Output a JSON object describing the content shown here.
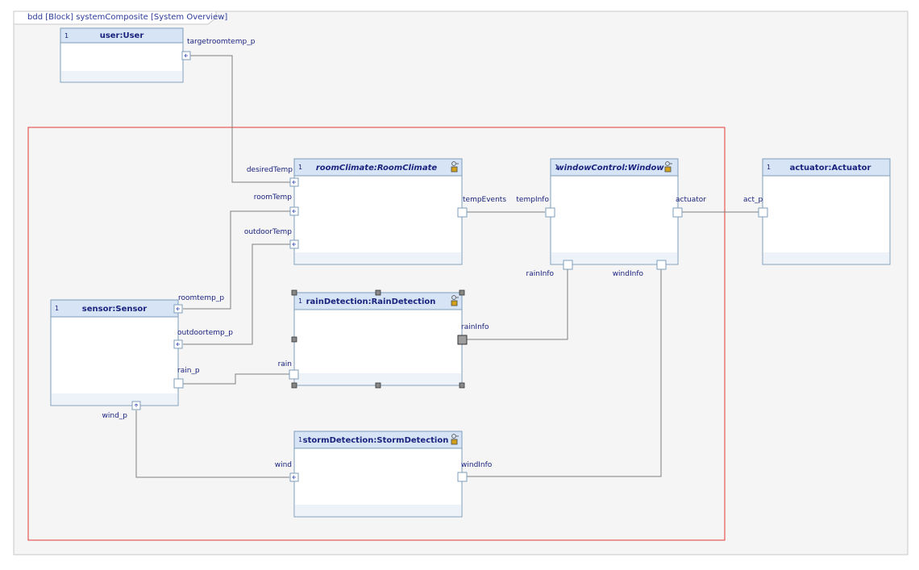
{
  "diagram": {
    "frame_title": "bdd [Block] systemComposite [System Overview]",
    "blocks": [
      {
        "id": "user",
        "multiplicity": "1",
        "label": "user:User",
        "italic": false,
        "has_icon": false
      },
      {
        "id": "roomclimate",
        "multiplicity": "1",
        "label": "roomClimate:RoomClimate",
        "italic": true,
        "has_icon": true
      },
      {
        "id": "windowcontrol",
        "multiplicity": "1",
        "label": "windowControl:Window",
        "italic": true,
        "has_icon": true
      },
      {
        "id": "actuator",
        "multiplicity": "1",
        "label": "actuator:Actuator",
        "italic": false,
        "has_icon": false
      },
      {
        "id": "sensor",
        "multiplicity": "1",
        "label": "sensor:Sensor",
        "italic": false,
        "has_icon": false
      },
      {
        "id": "raindetection",
        "multiplicity": "1",
        "label": "rainDetection:RainDetection",
        "italic": false,
        "has_icon": true
      },
      {
        "id": "stormdetection",
        "multiplicity": "1",
        "label": "stormDetection:StormDetection",
        "italic": false,
        "has_icon": true
      }
    ],
    "ports": [
      {
        "id": "targetroomtemp_p",
        "label": "targetroomtemp_p",
        "block": "user",
        "flow": true
      },
      {
        "id": "desiredTemp",
        "label": "desiredTemp",
        "block": "roomclimate",
        "flow": true
      },
      {
        "id": "roomTemp",
        "label": "roomTemp",
        "block": "roomclimate",
        "flow": true
      },
      {
        "id": "outdoorTemp",
        "label": "outdoorTemp",
        "block": "roomclimate",
        "flow": true
      },
      {
        "id": "tempEvents",
        "label": "tempEvents",
        "block": "roomclimate",
        "flow": false
      },
      {
        "id": "tempInfo",
        "label": "tempInfo",
        "block": "windowcontrol",
        "flow": false
      },
      {
        "id": "actuator_port",
        "label": "actuator",
        "block": "windowcontrol",
        "flow": false
      },
      {
        "id": "rainInfo_in",
        "label": "rainInfo",
        "block": "windowcontrol",
        "flow": false
      },
      {
        "id": "windInfo_in",
        "label": "windInfo",
        "block": "windowcontrol",
        "flow": false
      },
      {
        "id": "act_p",
        "label": "act_p",
        "block": "actuator",
        "flow": false
      },
      {
        "id": "roomtemp_p",
        "label": "roomtemp_p",
        "block": "sensor",
        "flow": true
      },
      {
        "id": "outdoortemp_p",
        "label": "outdoortemp_p",
        "block": "sensor",
        "flow": true
      },
      {
        "id": "rain_p",
        "label": "rain_p",
        "block": "sensor",
        "flow": false
      },
      {
        "id": "wind_p",
        "label": "wind_p",
        "block": "sensor",
        "flow": true
      },
      {
        "id": "rain",
        "label": "rain",
        "block": "raindetection",
        "flow": false
      },
      {
        "id": "rainInfo_out",
        "label": "rainInfo",
        "block": "raindetection",
        "flow": false
      },
      {
        "id": "wind",
        "label": "wind",
        "block": "stormdetection",
        "flow": true
      },
      {
        "id": "windInfo_out",
        "label": "windInfo",
        "block": "stormdetection",
        "flow": false
      }
    ],
    "connectors": [
      {
        "from": "targetroomtemp_p",
        "to": "desiredTemp"
      },
      {
        "from": "roomtemp_p",
        "to": "roomTemp"
      },
      {
        "from": "outdoortemp_p",
        "to": "outdoorTemp"
      },
      {
        "from": "rain_p",
        "to": "rain"
      },
      {
        "from": "wind_p",
        "to": "wind"
      },
      {
        "from": "tempEvents",
        "to": "tempInfo"
      },
      {
        "from": "rainInfo_out",
        "to": "rainInfo_in"
      },
      {
        "from": "windInfo_out",
        "to": "windInfo_in"
      },
      {
        "from": "actuator_port",
        "to": "act_p"
      }
    ],
    "colors": {
      "header_fill": "#d6e4f5",
      "block_border": "#7f9db9",
      "label_text": "#1a237e",
      "selection_border": "#e53935",
      "connector": "#808080",
      "canvas_bg": "#f5f5f5"
    }
  }
}
